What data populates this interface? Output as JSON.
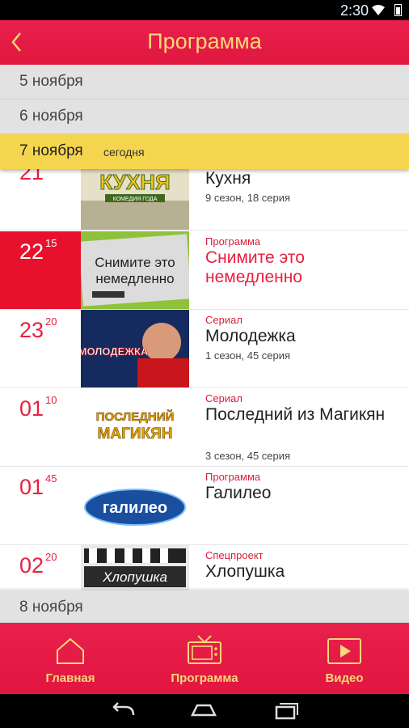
{
  "status_bar": {
    "time": "2:30"
  },
  "app_bar": {
    "title": "Программа",
    "back_icon": "back-chevron-icon"
  },
  "days": [
    {
      "label": "5 ноября"
    },
    {
      "label": "6 ноября"
    },
    {
      "label": "7 ноября",
      "badge": "сегодня",
      "active": true
    },
    {
      "label": "8 ноября"
    }
  ],
  "programs": [
    {
      "hour": "21",
      "minute": "",
      "category": "",
      "title": "Кухня",
      "episode": "9 сезон, 18 серия",
      "thumb_text": "КУХНЯ",
      "thumb_subtext": "КОМЕДИЯ ГОДА"
    },
    {
      "hour": "22",
      "minute": "15",
      "category": "Программа",
      "title": "Снимите это немедленно",
      "episode": "",
      "thumb_text": "Снимите это немедленно",
      "current": true
    },
    {
      "hour": "23",
      "minute": "20",
      "category": "Сериал",
      "title": "Молодежка",
      "episode": "1 сезон, 45 серия",
      "thumb_text": "МОЛОДЕЖКА"
    },
    {
      "hour": "01",
      "minute": "10",
      "category": "Сериал",
      "title": "Последний из Магикян",
      "episode": "3 сезон, 45 серия",
      "thumb_text": "ПОСЛЕДНИЙ",
      "thumb_subtext": "МАГИКЯН"
    },
    {
      "hour": "01",
      "minute": "45",
      "category": "Программа",
      "title": "Галилео",
      "episode": "",
      "thumb_text": "галилео"
    },
    {
      "hour": "02",
      "minute": "20",
      "category": "Спецпроект",
      "title": "Хлопушка",
      "episode": "",
      "thumb_text": "Хлопушка"
    }
  ],
  "bottom_nav": [
    {
      "label": "Главная",
      "icon": "home-icon"
    },
    {
      "label": "Программа",
      "icon": "tv-icon"
    },
    {
      "label": "Видео",
      "icon": "play-icon"
    }
  ],
  "colors": {
    "accent": "#e8203e",
    "highlight_day": "#f6d54e",
    "nav_text": "#f7d77a"
  }
}
